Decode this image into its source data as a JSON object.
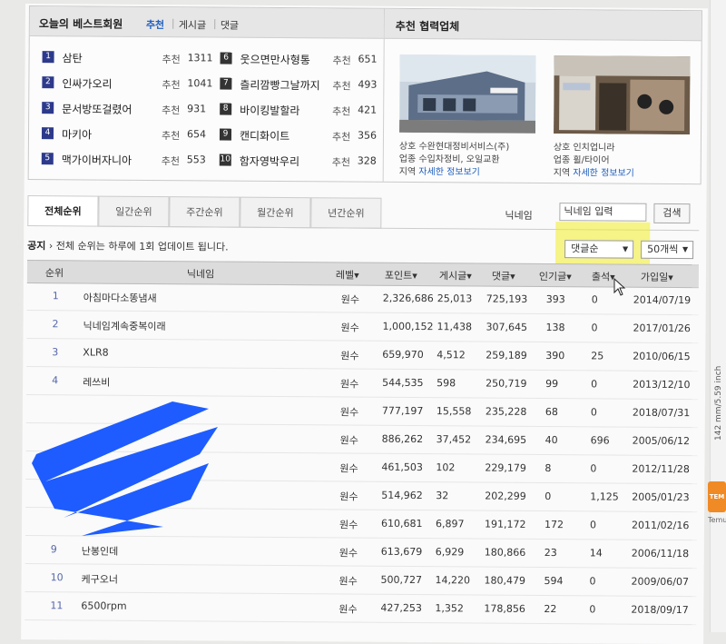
{
  "best": {
    "title": "오늘의 베스트회원",
    "tabs": [
      "추천",
      "게시글",
      "댓글"
    ],
    "rec_label": "추천",
    "items": [
      {
        "rank": "1",
        "name": "삼탄",
        "count": "1311"
      },
      {
        "rank": "2",
        "name": "인싸가오리",
        "count": "1041"
      },
      {
        "rank": "3",
        "name": "문서방또걸렸어",
        "count": "931"
      },
      {
        "rank": "4",
        "name": "마키아",
        "count": "654"
      },
      {
        "rank": "5",
        "name": "맥가이버자니아",
        "count": "553"
      },
      {
        "rank": "6",
        "name": "웃으면만사형통",
        "count": "651"
      },
      {
        "rank": "7",
        "name": "츨리깜빵그날까지",
        "count": "493"
      },
      {
        "rank": "8",
        "name": "바이킹발할라",
        "count": "421"
      },
      {
        "rank": "9",
        "name": "캔디화이트",
        "count": "356"
      },
      {
        "rank": "10",
        "name": "함자영박우리",
        "count": "328"
      }
    ]
  },
  "partners": {
    "title": "추천 협력업체",
    "items": [
      {
        "name_label": "상호",
        "name": "수완현대정비서비스(주)",
        "biz_label": "업종",
        "biz": "수입차정비, 오일교환",
        "region_label": "지역",
        "region_link": "자세한 정보보기"
      },
      {
        "name_label": "상호",
        "name": "인치업니라",
        "biz_label": "업종",
        "biz": "휠/타이어",
        "region_label": "지역",
        "region_link": "자세한 정보보기"
      }
    ]
  },
  "tabs": [
    "전체순위",
    "일간순위",
    "주간순위",
    "월간순위",
    "년간순위"
  ],
  "search": {
    "label": "닉네임",
    "placeholder": "닉네임 입력",
    "button": "검색"
  },
  "notice": {
    "prefix": "공지",
    "text": "전체 순위는 하루에 1회 업데이트 됩니다."
  },
  "sort": {
    "selected": "댓글순",
    "per_page": "50개씩"
  },
  "columns": [
    "순위",
    "닉네임",
    "레벨▾",
    "포인트▾",
    "게시글▾",
    "댓글▾",
    "인기글▾",
    "출석▾",
    "가입일▾"
  ],
  "rows": [
    {
      "rank": "1",
      "nick": "아침마다소똥냄새",
      "level": "원수",
      "points": "2,326,686",
      "posts": "25,013",
      "comments": "725,193",
      "popular": "393",
      "attend": "0",
      "joined": "2014/07/19"
    },
    {
      "rank": "2",
      "nick": "닉네임계속중복이래",
      "level": "원수",
      "points": "1,000,152",
      "posts": "11,438",
      "comments": "307,645",
      "popular": "138",
      "attend": "0",
      "joined": "2017/01/26"
    },
    {
      "rank": "3",
      "nick": "XLR8",
      "level": "원수",
      "points": "659,970",
      "posts": "4,512",
      "comments": "259,189",
      "popular": "390",
      "attend": "25",
      "joined": "2010/06/15"
    },
    {
      "rank": "4",
      "nick": "레쓰비",
      "level": "원수",
      "points": "544,535",
      "posts": "598",
      "comments": "250,719",
      "popular": "99",
      "attend": "0",
      "joined": "2013/12/10"
    },
    {
      "rank": "",
      "nick": "",
      "level": "원수",
      "points": "777,197",
      "posts": "15,558",
      "comments": "235,228",
      "popular": "68",
      "attend": "0",
      "joined": "2018/07/31"
    },
    {
      "rank": "",
      "nick": "",
      "level": "원수",
      "points": "886,262",
      "posts": "37,452",
      "comments": "234,695",
      "popular": "40",
      "attend": "696",
      "joined": "2005/06/12"
    },
    {
      "rank": "",
      "nick": "",
      "level": "원수",
      "points": "461,503",
      "posts": "102",
      "comments": "229,179",
      "popular": "8",
      "attend": "0",
      "joined": "2012/11/28"
    },
    {
      "rank": "",
      "nick": "",
      "level": "원수",
      "points": "514,962",
      "posts": "32",
      "comments": "202,299",
      "popular": "0",
      "attend": "1,125",
      "joined": "2005/01/23"
    },
    {
      "rank": "",
      "nick": "",
      "level": "원수",
      "points": "610,681",
      "posts": "6,897",
      "comments": "191,172",
      "popular": "172",
      "attend": "0",
      "joined": "2011/02/16"
    },
    {
      "rank": "9",
      "nick": "난봉인데",
      "level": "원수",
      "points": "613,679",
      "posts": "6,929",
      "comments": "180,866",
      "popular": "23",
      "attend": "14",
      "joined": "2006/11/18"
    },
    {
      "rank": "10",
      "nick": "케구오너",
      "level": "원수",
      "points": "500,727",
      "posts": "14,220",
      "comments": "180,479",
      "popular": "594",
      "attend": "0",
      "joined": "2009/06/07"
    },
    {
      "rank": "11",
      "nick": "6500rpm",
      "level": "원수",
      "points": "427,253",
      "posts": "1,352",
      "comments": "178,856",
      "popular": "22",
      "attend": "0",
      "joined": "2018/09/17"
    }
  ],
  "side": {
    "measure": "142 mm/5.59 inch",
    "badge": "TEM",
    "badge_label": "Temu"
  },
  "colors": {
    "accent": "#1f5fbf",
    "rank_box": "#2d3a8c",
    "highlight": "#f2ec28",
    "redaction": "#1e5cff"
  }
}
